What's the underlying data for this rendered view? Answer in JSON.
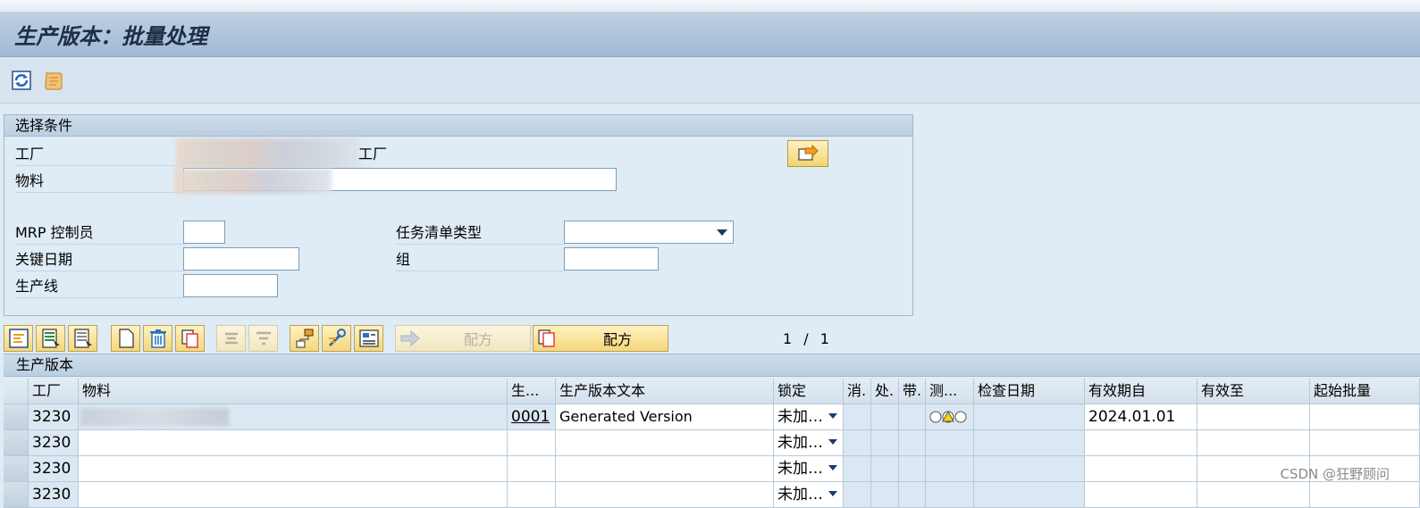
{
  "title": "生产版本：批量处理",
  "toolbar": {
    "icons": [
      "refresh-icon",
      "scroll-icon"
    ]
  },
  "selection": {
    "header": "选择条件",
    "plant_label": "工厂",
    "plant_suffix": "工厂",
    "material_label": "物料",
    "mrp_label": "MRP 控制员",
    "key_date_label": "关键日期",
    "prod_line_label": "生产线",
    "task_list_type_label": "任务清单类型",
    "group_label": "组"
  },
  "buttons": {
    "recipe_disabled_label": "配方",
    "recipe_label": "配方"
  },
  "pager": {
    "current": "1",
    "sep": "/",
    "total": "1"
  },
  "grid": {
    "title": "生产版本",
    "columns": [
      "工厂",
      "物料",
      "生...",
      "生产版本文本",
      "锁定",
      "消.",
      "处.",
      "带.",
      "测...",
      "检查日期",
      "有效期自",
      "有效至",
      "起始批量"
    ],
    "rows": [
      {
        "plant": "3230",
        "version": "0001",
        "text": "Generated Version",
        "lock": "未加…",
        "valid_from": "2024.01.01"
      },
      {
        "plant": "3230",
        "version": "",
        "text": "",
        "lock": "未加…",
        "valid_from": ""
      },
      {
        "plant": "3230",
        "version": "",
        "text": "",
        "lock": "未加…",
        "valid_from": ""
      },
      {
        "plant": "3230",
        "version": "",
        "text": "",
        "lock": "未加…",
        "valid_from": ""
      }
    ]
  },
  "watermark": "CSDN @狂野顾问"
}
